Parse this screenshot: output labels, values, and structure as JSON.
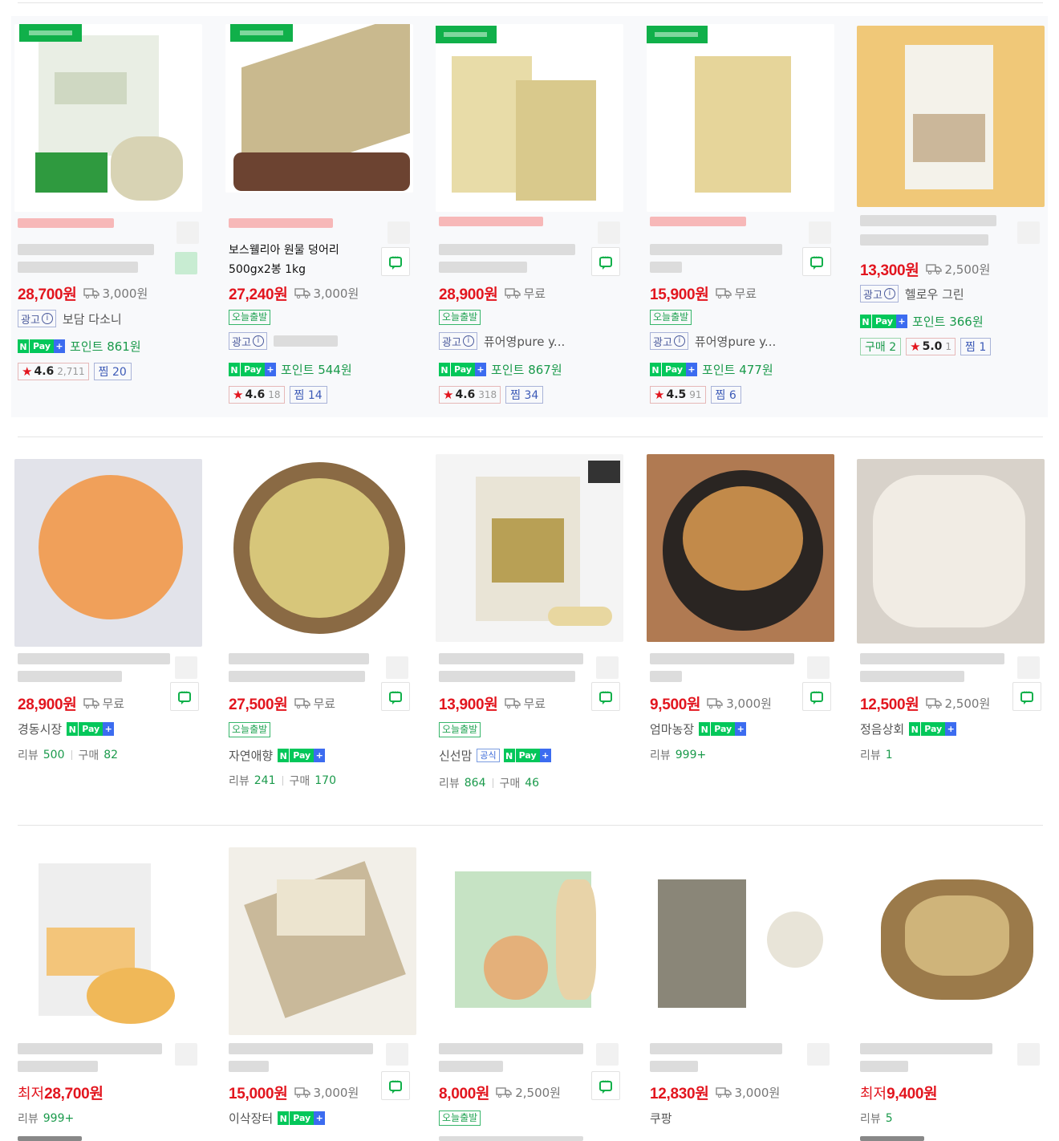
{
  "rows": [
    [
      {
        "price": "28,700원",
        "ship": "3,000원",
        "seller": "보담 다소니",
        "points": "포인트 861원",
        "rating": "4.6",
        "rating_count": "2,711",
        "zzim": "찜 20"
      },
      {
        "title": "보스웰리아 원물 덩어리 500gx2봉 1kg",
        "price": "27,240원",
        "ship": "3,000원",
        "today": "오늘출발",
        "points": "포인트 544원",
        "rating": "4.6",
        "rating_count": "18",
        "zzim": "찜 14"
      },
      {
        "price": "28,900원",
        "ship": "무료",
        "today": "오늘출발",
        "seller": "퓨어영pure y...",
        "points": "포인트 867원",
        "rating": "4.6",
        "rating_count": "318",
        "zzim": "찜 34"
      },
      {
        "price": "15,900원",
        "ship": "무료",
        "today": "오늘출발",
        "seller": "퓨어영pure y...",
        "points": "포인트 477원",
        "rating": "4.5",
        "rating_count": "91",
        "zzim": "찜 6"
      },
      {
        "price": "13,300원",
        "ship": "2,500원",
        "seller": "헬로우 그린",
        "points": "포인트 366원",
        "buy": "구매 2",
        "rating": "5.0",
        "rating_count": "1",
        "zzim": "찜 1"
      }
    ],
    [
      {
        "price": "28,900원",
        "ship": "무료",
        "seller": "경동시장",
        "rev_label": "리뷰",
        "rev": "500",
        "buy_label": "구매",
        "buy": "82"
      },
      {
        "price": "27,500원",
        "ship": "무료",
        "today": "오늘출발",
        "seller": "자연애향",
        "rev_label": "리뷰",
        "rev": "241",
        "buy_label": "구매",
        "buy": "170"
      },
      {
        "price": "13,900원",
        "ship": "무료",
        "today": "오늘출발",
        "seller": "신선맘",
        "official": "공식",
        "rev_label": "리뷰",
        "rev": "864",
        "buy_label": "구매",
        "buy": "46"
      },
      {
        "price": "9,500원",
        "ship": "3,000원",
        "seller": "엄마농장",
        "rev_label": "리뷰",
        "rev": "999+"
      },
      {
        "price": "12,500원",
        "ship": "2,500원",
        "seller": "정음상회",
        "rev_label": "리뷰",
        "rev": "1"
      }
    ],
    [
      {
        "lowest": "최저",
        "price": "28,700원",
        "rev_label": "리뷰",
        "rev": "999+"
      },
      {
        "price": "15,000원",
        "ship": "3,000원",
        "seller": "이삭장터"
      },
      {
        "price": "8,000원",
        "ship": "2,500원",
        "today": "오늘출발"
      },
      {
        "price": "12,830원",
        "ship": "3,000원",
        "seller": "쿠팡"
      },
      {
        "lowest": "최저",
        "price": "9,400원",
        "rev_label": "리뷰",
        "rev": "5"
      }
    ]
  ],
  "labels": {
    "ad": "광고",
    "info": "i",
    "npay_n": "N",
    "npay_pay": "Pay",
    "npay_plus": "+",
    "star": "★"
  },
  "icons": {
    "chat": "chat-bubble-icon",
    "truck": "delivery-truck-icon",
    "star": "star-icon"
  },
  "colors": {
    "price": "#e2151e",
    "green": "#10b04a",
    "npay": "#03c75a",
    "blue": "#3d5bb7"
  }
}
